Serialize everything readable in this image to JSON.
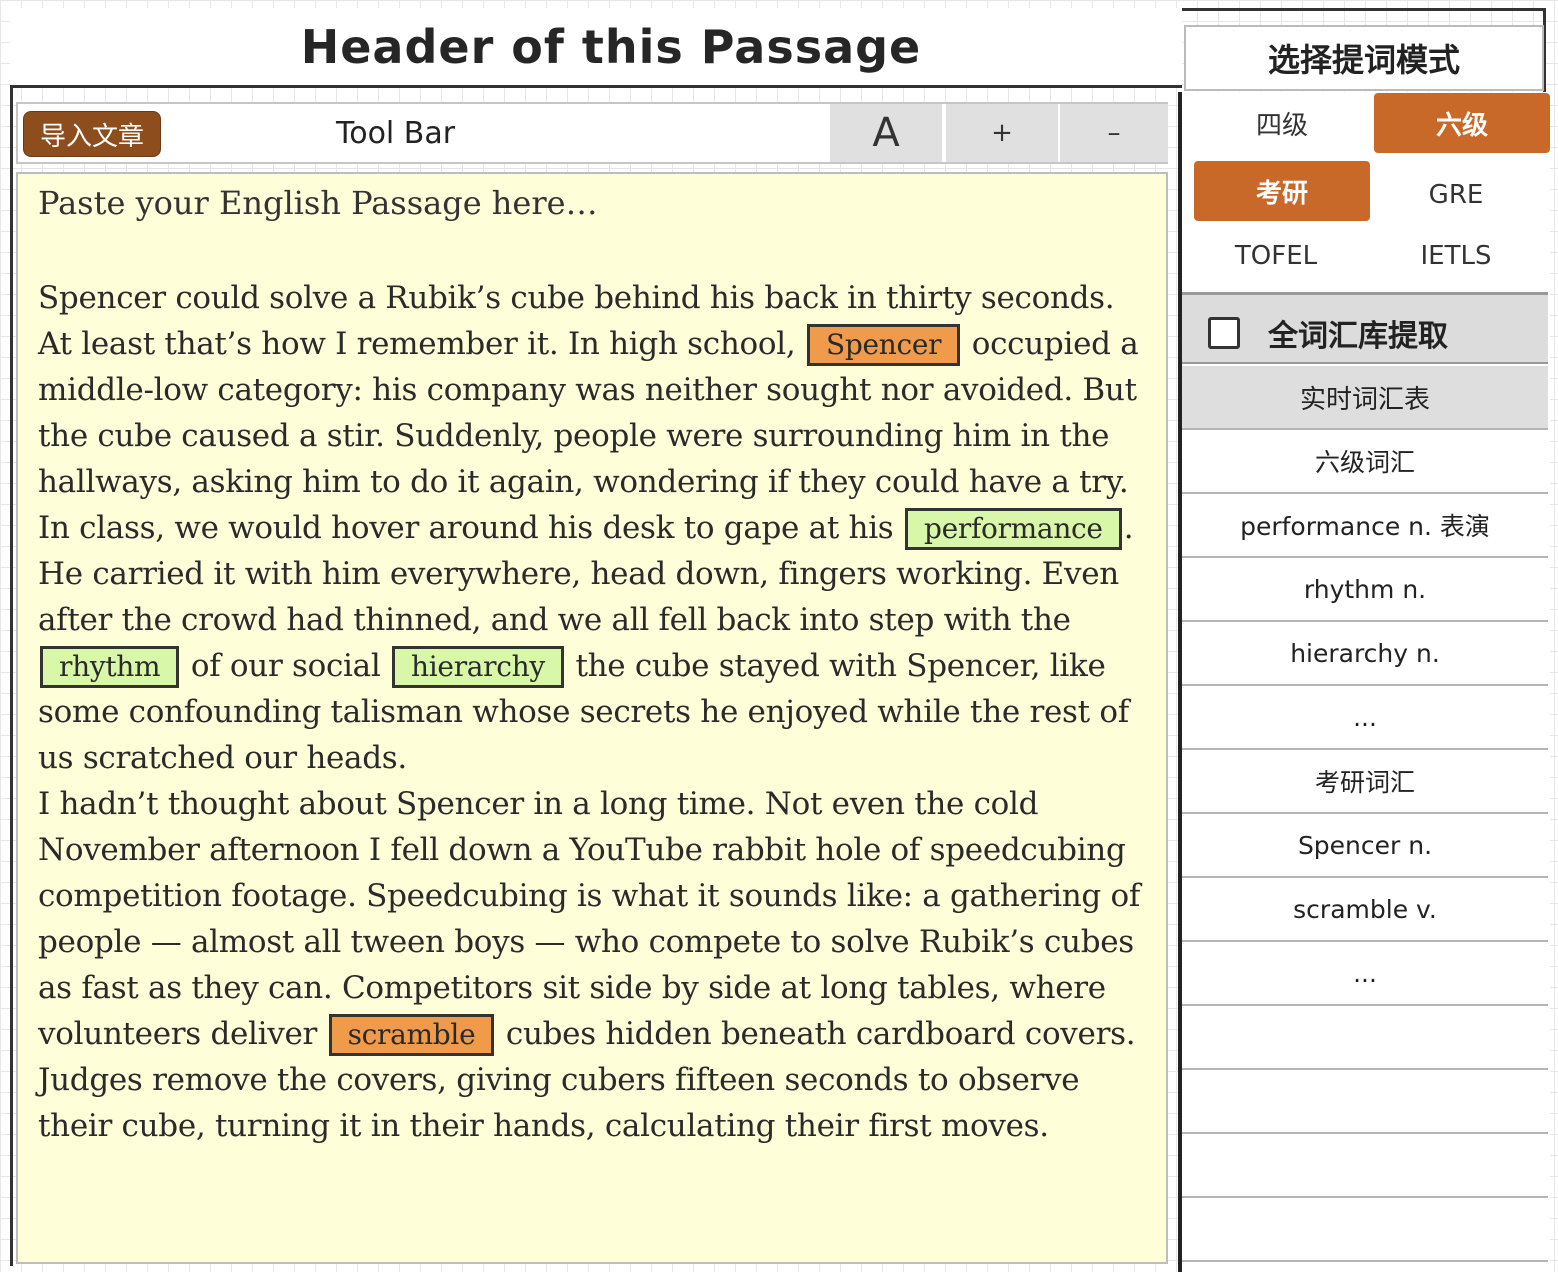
{
  "header": {
    "title": "Header of this Passage"
  },
  "toolbar": {
    "import_label": "导入文章",
    "label": "Tool Bar",
    "font_label": "A",
    "increase_label": "+",
    "decrease_label": "–"
  },
  "editor": {
    "placeholder": "Paste your English Passage here…",
    "segments": [
      {
        "t": "Spencer could solve a Rubik’s cube behind his back in thirty seconds. At least that’s how I remember it. In high school, "
      },
      {
        "t": "Spencer",
        "hl": "orange"
      },
      {
        "t": " occupied a middle-low category: his company was neither sought nor avoided. But the cube caused a stir. Suddenly, people were surrounding him in the hallways, asking him to do it again, wondering if they could have a try. In class, we would hover around his desk to gape at his "
      },
      {
        "t": "performance",
        "hl": "green"
      },
      {
        "t": ". He carried it with him everywhere, head down, fingers working. Even after the crowd had thinned, and we all fell back into step with the "
      },
      {
        "t": "rhythm",
        "hl": "green"
      },
      {
        "t": " of our social "
      },
      {
        "t": "hierarchy",
        "hl": "green"
      },
      {
        "t": " the cube stayed with Spencer, like some confounding talisman whose secrets he enjoyed while the rest of us scratched our heads."
      },
      {
        "t": "\n"
      },
      {
        "t": "I hadn’t thought about Spencer in a long time. Not even the cold November afternoon I fell down a YouTube rabbit hole of speedcubing competition footage. Speedcubing is what it sounds like: a gathering of people — almost all tween boys — who compete to solve Rubik’s cubes as fast as they can. Competitors sit side by side at long tables, where volunteers deliver "
      },
      {
        "t": "scramble",
        "hl": "orange"
      },
      {
        "t": " cubes hidden beneath cardboard covers. Judges remove the covers, giving cubers fifteen seconds to observe their cube, turning it in their hands, calculating their first moves."
      }
    ]
  },
  "sidebar": {
    "mode_title": "选择提词模式",
    "levels": [
      {
        "label": "四级",
        "active": false
      },
      {
        "label": "六级",
        "active": true
      },
      {
        "label": "考研",
        "active": true
      },
      {
        "label": "GRE",
        "active": false
      },
      {
        "label": "TOFEL",
        "active": false
      },
      {
        "label": "IETLS",
        "active": false
      }
    ],
    "full_library_label": "全词汇库提取",
    "full_library_checked": false,
    "vocab_header": "实时词汇表",
    "vocab_rows": [
      "六级词汇",
      "performance n. 表演",
      "rhythm n.",
      "hierarchy n.",
      "...",
      "考研词汇",
      "Spencer n.",
      "scramble v.",
      "...",
      "",
      "",
      "",
      ""
    ]
  },
  "colors": {
    "accent_orange": "#c8692a",
    "highlight_orange": "#ef9b4b",
    "highlight_green": "#d9f7a8",
    "editor_bg": "#fefed9",
    "import_button": "#8e4d1d"
  }
}
